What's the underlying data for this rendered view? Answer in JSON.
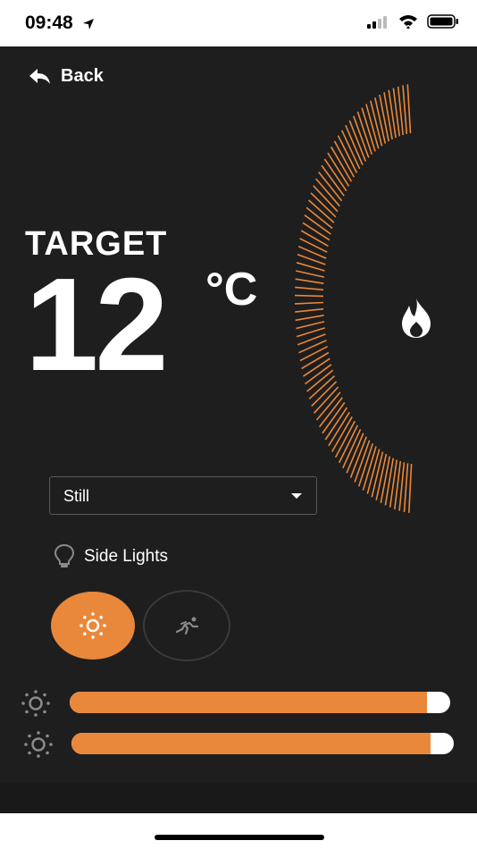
{
  "status_bar": {
    "time": "09:48",
    "icons": [
      "location-arrow-icon",
      "signal-icon",
      "wifi-icon",
      "battery-icon"
    ]
  },
  "nav": {
    "back_label": "Back",
    "back_icon": "reply-arrow-icon"
  },
  "thermostat": {
    "target_label": "TARGET",
    "temperature": "12",
    "unit": "°C",
    "mode_icon": "flame-icon",
    "accent_color": "#e9883b",
    "background_color": "#1e1e1e"
  },
  "mode_select": {
    "value": "Still"
  },
  "lights": {
    "label": "Side Lights",
    "icon": "lightbulb-icon",
    "buttons": [
      {
        "icon": "sun-icon",
        "active": true
      },
      {
        "icon": "running-person-icon",
        "active": false
      }
    ]
  },
  "sliders": [
    {
      "icon": "brightness-icon",
      "level_percent": 94
    },
    {
      "icon": "brightness-icon",
      "level_percent": 94
    }
  ]
}
